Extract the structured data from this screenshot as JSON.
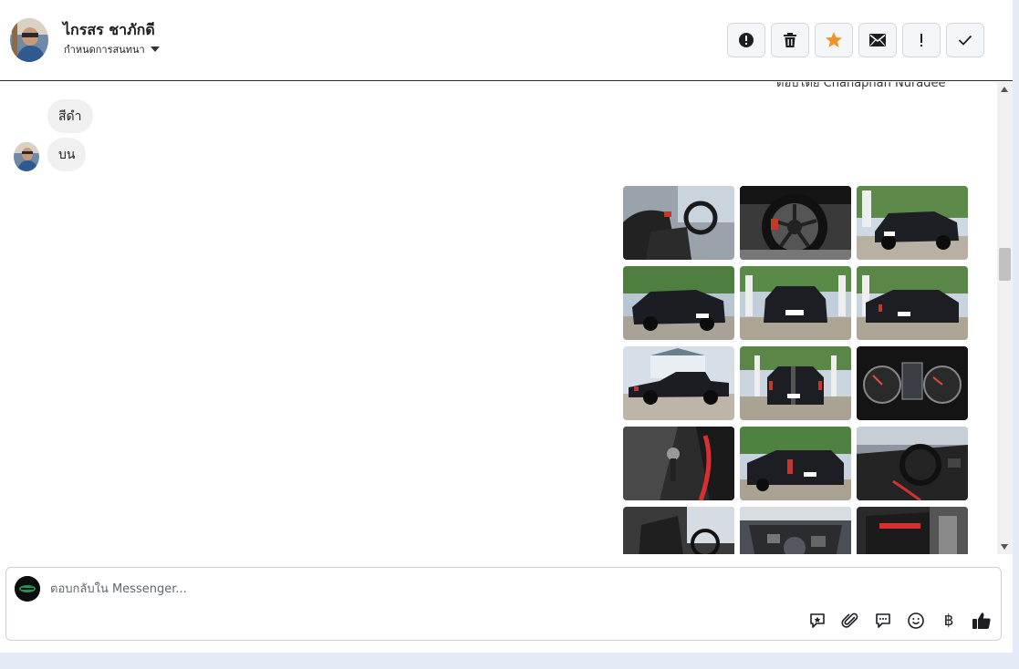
{
  "header": {
    "name": "ไกรสร ชาภักดี",
    "subtitle": "กำหนดการสนทนา",
    "toolbar": {
      "buttons": [
        {
          "name": "mark-spam-button",
          "icon": "alert-circle-icon"
        },
        {
          "name": "delete-button",
          "icon": "trash-icon"
        },
        {
          "name": "star-button",
          "icon": "star-icon",
          "color": "#f0932b"
        },
        {
          "name": "mark-unread-button",
          "icon": "envelope-icon"
        },
        {
          "name": "mark-important-button",
          "icon": "exclamation-icon"
        },
        {
          "name": "mark-done-button",
          "icon": "check-icon"
        }
      ]
    }
  },
  "conversation": {
    "clipped_top_text": "ตอบโดย Chanaphan Nuradee",
    "messages": [
      {
        "side": "incoming",
        "text": "สีดำ"
      },
      {
        "side": "incoming",
        "text": "บน"
      }
    ],
    "photo_count": 15
  },
  "composer": {
    "placeholder": "ตอบกลับใน Messenger...",
    "icons": [
      "sticker-icon",
      "paperclip-icon",
      "saved-reply-icon",
      "emoji-icon",
      "baht-icon",
      "thumbs-up-icon"
    ],
    "baht_symbol": "฿"
  }
}
